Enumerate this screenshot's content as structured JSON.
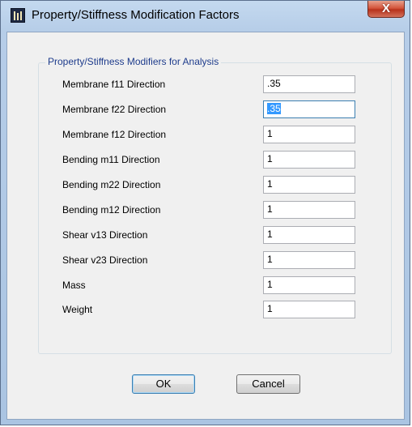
{
  "window": {
    "title": "Property/Stiffness Modification Factors",
    "close_glyph": "X",
    "icon": "app-icon"
  },
  "group": {
    "legend": "Property/Stiffness Modifiers for Analysis"
  },
  "fields": [
    {
      "label": "Membrane f11 Direction",
      "value": ".35"
    },
    {
      "label": "Membrane f22 Direction",
      "value": ".35",
      "selected": true
    },
    {
      "label": "Membrane f12 Direction",
      "value": "1"
    },
    {
      "label": "Bending m11 Direction",
      "value": "1"
    },
    {
      "label": "Bending m22 Direction",
      "value": "1"
    },
    {
      "label": "Bending m12 Direction",
      "value": "1"
    },
    {
      "label": "Shear v13 Direction",
      "value": "1"
    },
    {
      "label": "Shear v23 Direction",
      "value": "1"
    },
    {
      "label": "Mass",
      "value": "1"
    },
    {
      "label": "Weight",
      "value": "1"
    }
  ],
  "buttons": {
    "ok": "OK",
    "cancel": "Cancel"
  },
  "colors": {
    "legend_text": "#1e3c8c",
    "selection": "#3399ff",
    "close_button": "#c7432a"
  }
}
